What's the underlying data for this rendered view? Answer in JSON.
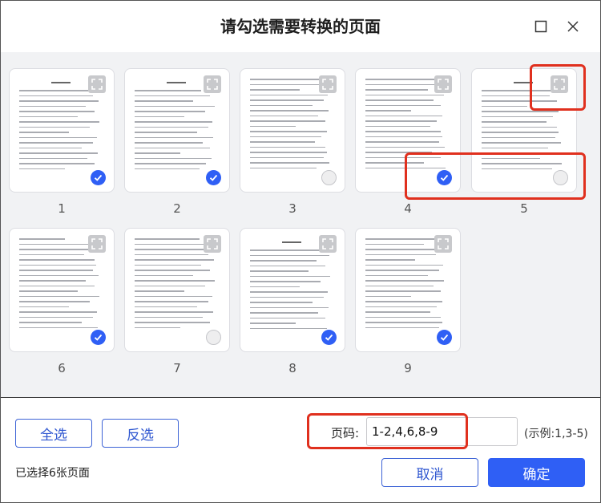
{
  "dialog": {
    "title": "请勾选需要转换的页面"
  },
  "pages": [
    {
      "number": "1",
      "selected": true,
      "title_bar": true
    },
    {
      "number": "2",
      "selected": true,
      "title_bar": true
    },
    {
      "number": "3",
      "selected": false,
      "title_bar": false
    },
    {
      "number": "4",
      "selected": true,
      "title_bar": false
    },
    {
      "number": "5",
      "selected": false,
      "title_bar": true
    },
    {
      "number": "6",
      "selected": true,
      "title_bar": false
    },
    {
      "number": "7",
      "selected": false,
      "title_bar": false
    },
    {
      "number": "8",
      "selected": true,
      "title_bar": true
    },
    {
      "number": "9",
      "selected": true,
      "title_bar": false
    }
  ],
  "footer": {
    "select_all": "全选",
    "invert": "反选",
    "selected_count": "已选择6张页面",
    "page_label": "页码:",
    "page_value": "1-2,4,6,8-9",
    "page_hint": "(示例:1,3-5)",
    "cancel": "取消",
    "confirm": "确定"
  },
  "colors": {
    "accent": "#2f5ff5",
    "highlight": "#e0301e",
    "grid_bg": "#f1f2f4"
  },
  "icons": {
    "maximize": "maximize-icon",
    "close": "close-icon",
    "expand": "expand-icon",
    "check": "check-icon"
  }
}
